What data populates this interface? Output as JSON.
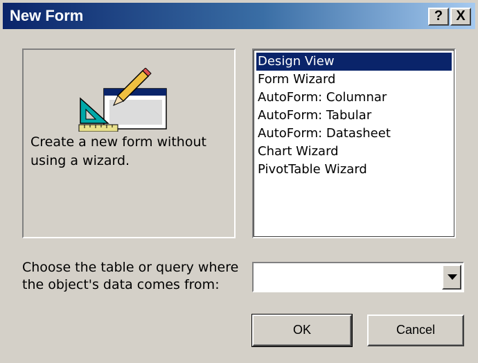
{
  "window": {
    "title": "New Form",
    "help_glyph": "?",
    "close_glyph": "X"
  },
  "preview": {
    "icon": "design-view-form-icon",
    "description": "Create a new form without using a wizard."
  },
  "form_types": [
    {
      "label": "Design View",
      "selected": true
    },
    {
      "label": "Form Wizard",
      "selected": false
    },
    {
      "label": "AutoForm:  Columnar",
      "selected": false
    },
    {
      "label": "AutoForm:  Tabular",
      "selected": false
    },
    {
      "label": "AutoForm:  Datasheet",
      "selected": false
    },
    {
      "label": "Chart Wizard",
      "selected": false
    },
    {
      "label": "PivotTable Wizard",
      "selected": false
    }
  ],
  "source": {
    "label": "Choose the table or query where the object's data comes from:",
    "value": ""
  },
  "buttons": {
    "ok": "OK",
    "cancel": "Cancel"
  },
  "colors": {
    "selection": "#0a246a",
    "face": "#d4d0c8"
  }
}
